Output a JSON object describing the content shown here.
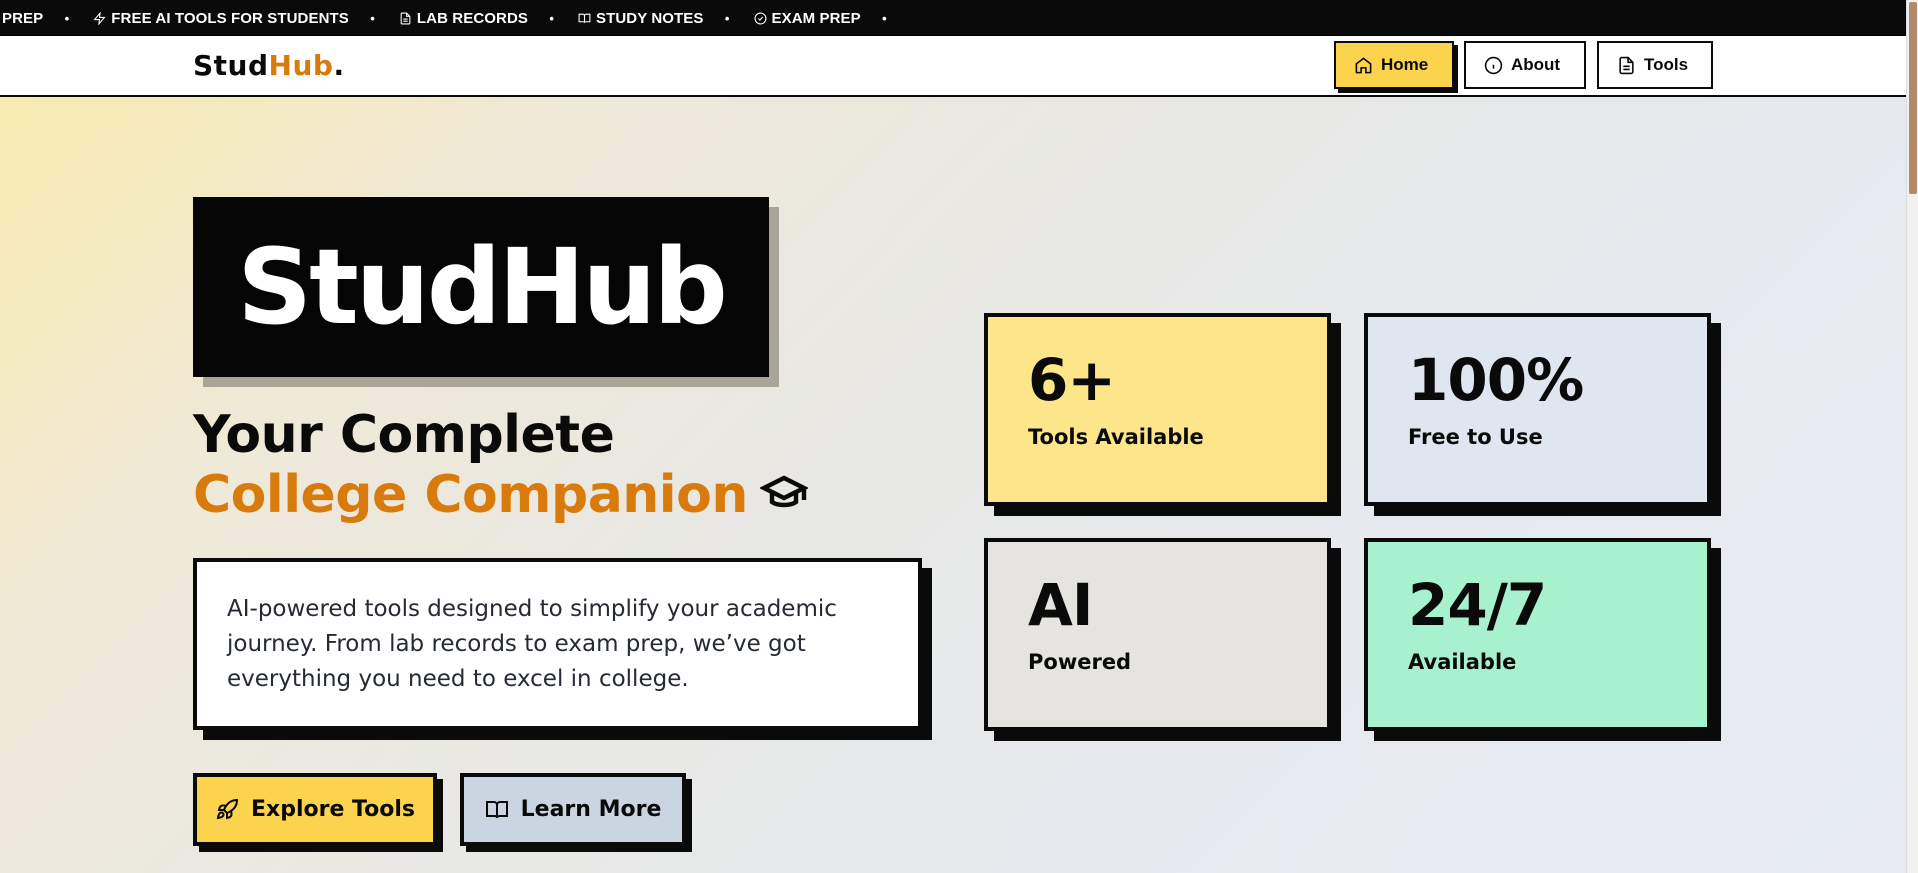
{
  "ticker": {
    "items": [
      {
        "label": "EXAM PREP",
        "icon": "circle-check-icon"
      },
      {
        "label": "FREE AI TOOLS FOR STUDENTS",
        "icon": "zap-icon"
      },
      {
        "label": "LAB RECORDS",
        "icon": "file-icon"
      },
      {
        "label": "STUDY NOTES",
        "icon": "book-icon"
      },
      {
        "label": "EXAM PREP",
        "icon": "circle-check-icon"
      }
    ]
  },
  "nav": {
    "logo_main": "Stud",
    "logo_accent": "Hub",
    "logo_dot": ".",
    "home": "Home",
    "about": "About",
    "tools": "Tools"
  },
  "hero": {
    "brand": "StudHub",
    "headline_1": "Your Complete",
    "headline_2": "College Companion",
    "description": "AI-powered tools designed to simplify your academic journey. From lab records to exam prep, we’ve got everything you need to excel in college.",
    "cta_primary": "Explore Tools",
    "cta_secondary": "Learn More"
  },
  "stats": [
    {
      "value": "6+",
      "label": "Tools Available",
      "color": "#fde58a"
    },
    {
      "value": "100%",
      "label": "Free to Use",
      "color": "#e0e6ef"
    },
    {
      "value": "AI",
      "label": "Powered",
      "color": "#e6e4e1"
    },
    {
      "value": "24/7",
      "label": "Available",
      "color": "#a7f1cf"
    }
  ],
  "colors": {
    "accent": "#d97a0c",
    "yellow": "#fcd34d",
    "ink": "#0a0a0a"
  }
}
